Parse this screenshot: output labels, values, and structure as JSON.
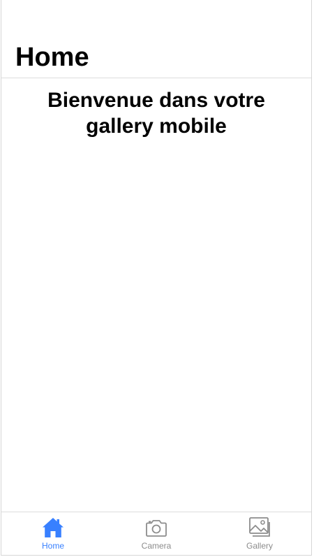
{
  "header": {
    "title": "Home"
  },
  "main": {
    "welcome_text": "Bienvenue dans votre gallery mobile"
  },
  "tabbar": {
    "tabs": [
      {
        "label": "Home",
        "icon": "home-icon",
        "active": true
      },
      {
        "label": "Camera",
        "icon": "camera-icon",
        "active": false
      },
      {
        "label": "Gallery",
        "icon": "images-icon",
        "active": false
      }
    ]
  },
  "colors": {
    "accent": "#3880ff",
    "inactive": "#8c8c8c",
    "divider": "#dcdcdc"
  }
}
